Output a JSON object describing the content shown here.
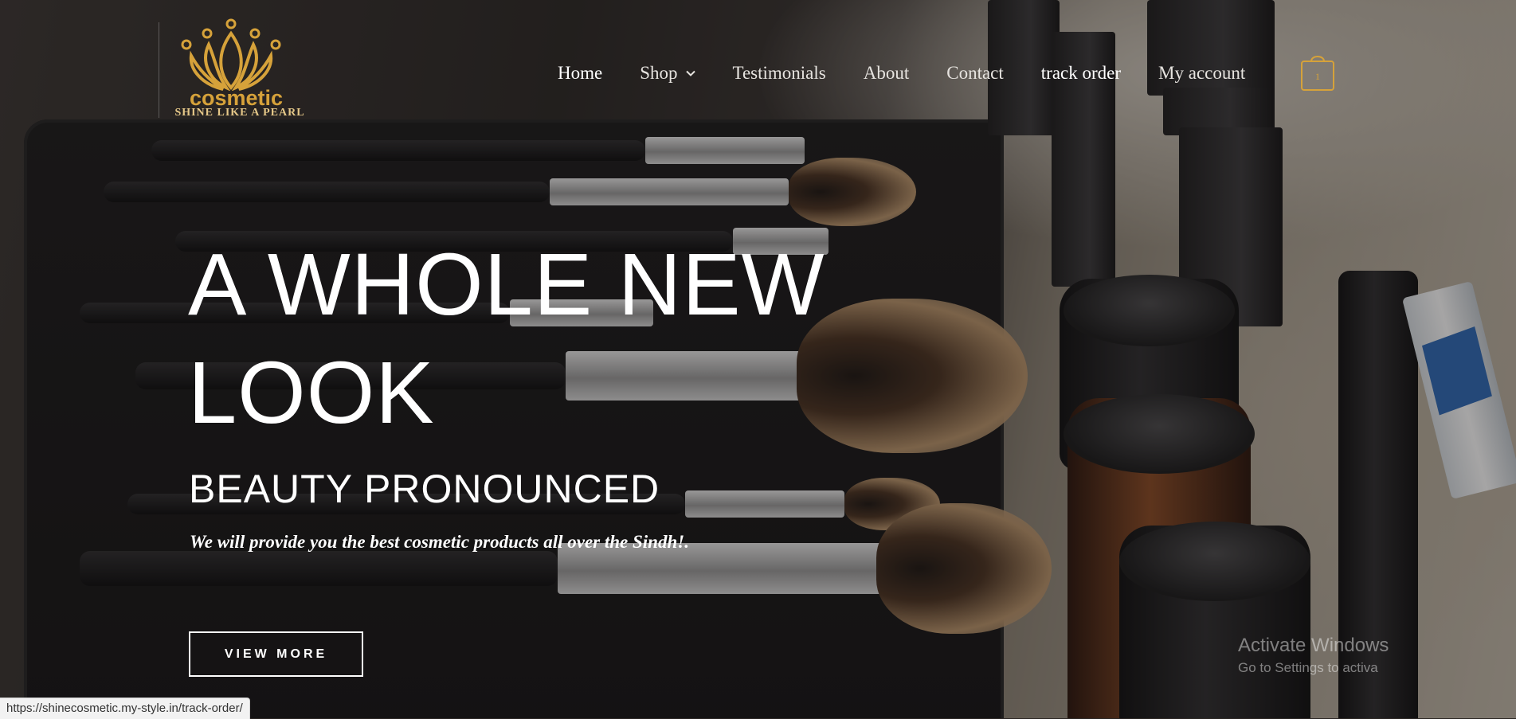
{
  "header": {
    "logo": {
      "brand": "cosmetic",
      "tagline": "SHINE LIKE A PEARL"
    },
    "nav": [
      {
        "label": "Home",
        "active": true
      },
      {
        "label": "Shop",
        "has_dropdown": true
      },
      {
        "label": "Testimonials"
      },
      {
        "label": "About"
      },
      {
        "label": "Contact"
      },
      {
        "label": "track order",
        "bold": true
      },
      {
        "label": "My account"
      }
    ],
    "cart": {
      "count": "1",
      "icon": "shopping-bag-icon"
    }
  },
  "hero": {
    "title": "A WHOLE NEW LOOK",
    "subtitle": "BEAUTY PRONOUNCED",
    "description": "We will provide you the best cosmetic products all over the Sindh!.",
    "cta_label": "VIEW MORE"
  },
  "overlay": {
    "activate_title": "Activate Windows",
    "activate_sub": "Go to Settings to activa"
  },
  "status_bar": {
    "url": "https://shinecosmetic.my-style.in/track-order/"
  },
  "colors": {
    "accent_gold": "#d6a23a",
    "text_white": "#ffffff"
  }
}
